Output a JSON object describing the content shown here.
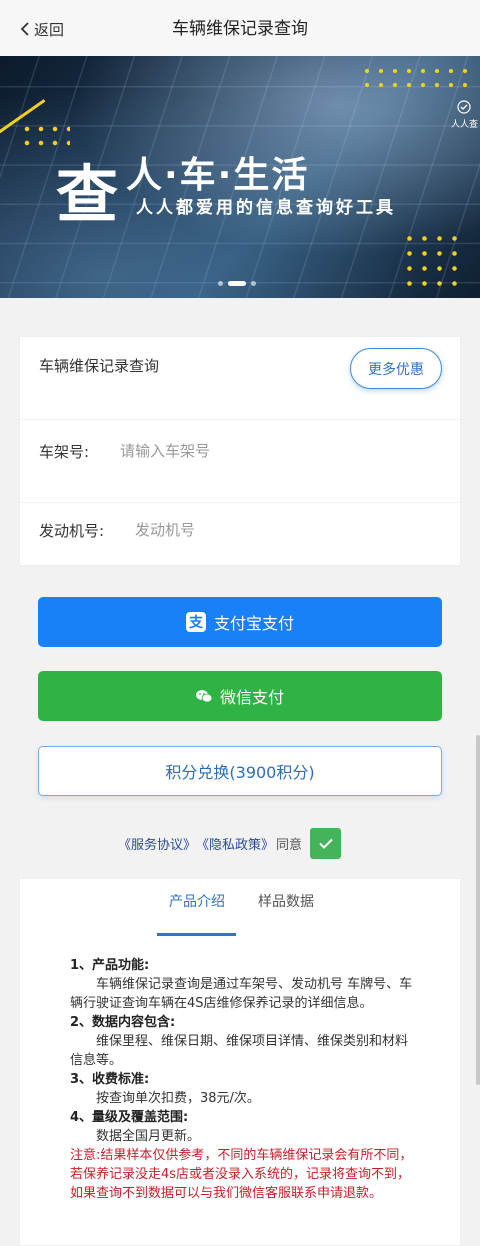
{
  "nav": {
    "back_label": "返回",
    "title": "车辆维保记录查询"
  },
  "banner": {
    "big_char": "查",
    "tagline": "人·车·生活",
    "subtitle": "人人都爱用的信息查询好工具",
    "brand": "人人查",
    "slide_index": 2,
    "slide_count": 3
  },
  "form": {
    "title": "车辆维保记录查询",
    "more_label": "更多优惠",
    "vin_label": "车架号:",
    "vin_placeholder": "请输入车架号",
    "engine_label": "发动机号:",
    "engine_placeholder": "发动机号"
  },
  "buttons": {
    "alipay_label": "支付宝支付",
    "wechat_label": "微信支付",
    "points_label": "积分兑换(3900积分)"
  },
  "agreement": {
    "service": "《服务协议》",
    "privacy": "《隐私政策》",
    "agree_text": "同意",
    "checked": true
  },
  "tabs": {
    "intro": "产品介绍",
    "sample": "样品数据"
  },
  "intro": {
    "h1": "1、产品功能:",
    "p1": "车辆维保记录查询是通过车架号、发动机号 车牌号、车辆行驶证查询车辆在4S店维修保养记录的详细信息。",
    "h2": "2、数据内容包含:",
    "p2": "维保里程、维保日期、维保项目详情、维保类别和材料信息等。",
    "h3": "3、收费标准:",
    "p3": "按查询单次扣费，38元/次。",
    "h4": "4、量级及覆盖范围:",
    "p4": "数据全国月更新。",
    "note": "注意:结果样本仅供参考，不同的车辆维保记录会有所不同，若保养记录没走4s店或者没录入系统的，记录将查询不到，如果查询不到数据可以与我们微信客服联系申请退款。"
  },
  "colors": {
    "primary": "#2e74c8",
    "alipay": "#1981f7",
    "wechat": "#2fb345",
    "warning": "#c8202a"
  }
}
